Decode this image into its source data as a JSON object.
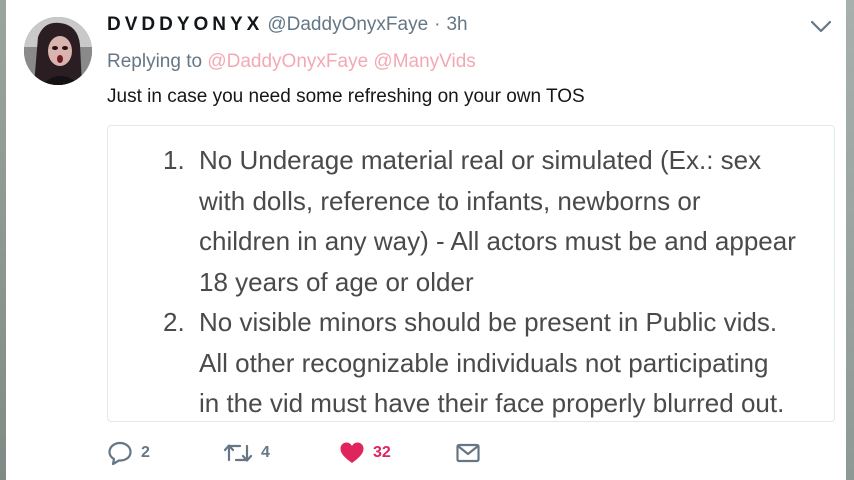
{
  "tweet": {
    "display_name": "DVDDYONYX",
    "handle": "@DaddyOnyxFaye",
    "separator": "·",
    "time": "3h",
    "replying_prefix": "Replying to",
    "mentions": [
      "@DaddyOnyxFaye",
      "@ManyVids"
    ],
    "text": "Just in case you need some refreshing on your own TOS",
    "media": {
      "items": [
        {
          "number": "1.",
          "lines": [
            "No Underage material real or simulated (Ex.: sex",
            "with dolls, reference to infants, newborns or",
            "children in any way) - All actors must be and appear",
            "18 years of age or older"
          ]
        },
        {
          "number": "2.",
          "lines": [
            "No visible minors should be present in Public vids.",
            "All other recognizable individuals not participating",
            "in the vid must have their face properly blurred out."
          ]
        }
      ]
    },
    "actions": {
      "reply_count": "2",
      "retweet_count": "4",
      "like_count": "32"
    }
  },
  "icons": {
    "reply": "reply-bubble-icon",
    "retweet": "retweet-icon",
    "like": "heart-icon",
    "message": "envelope-icon",
    "menu": "chevron-down-icon"
  },
  "colors": {
    "text": "#14171a",
    "secondary": "#657786",
    "mention": "#f3a9b4",
    "like": "#e0245e"
  }
}
